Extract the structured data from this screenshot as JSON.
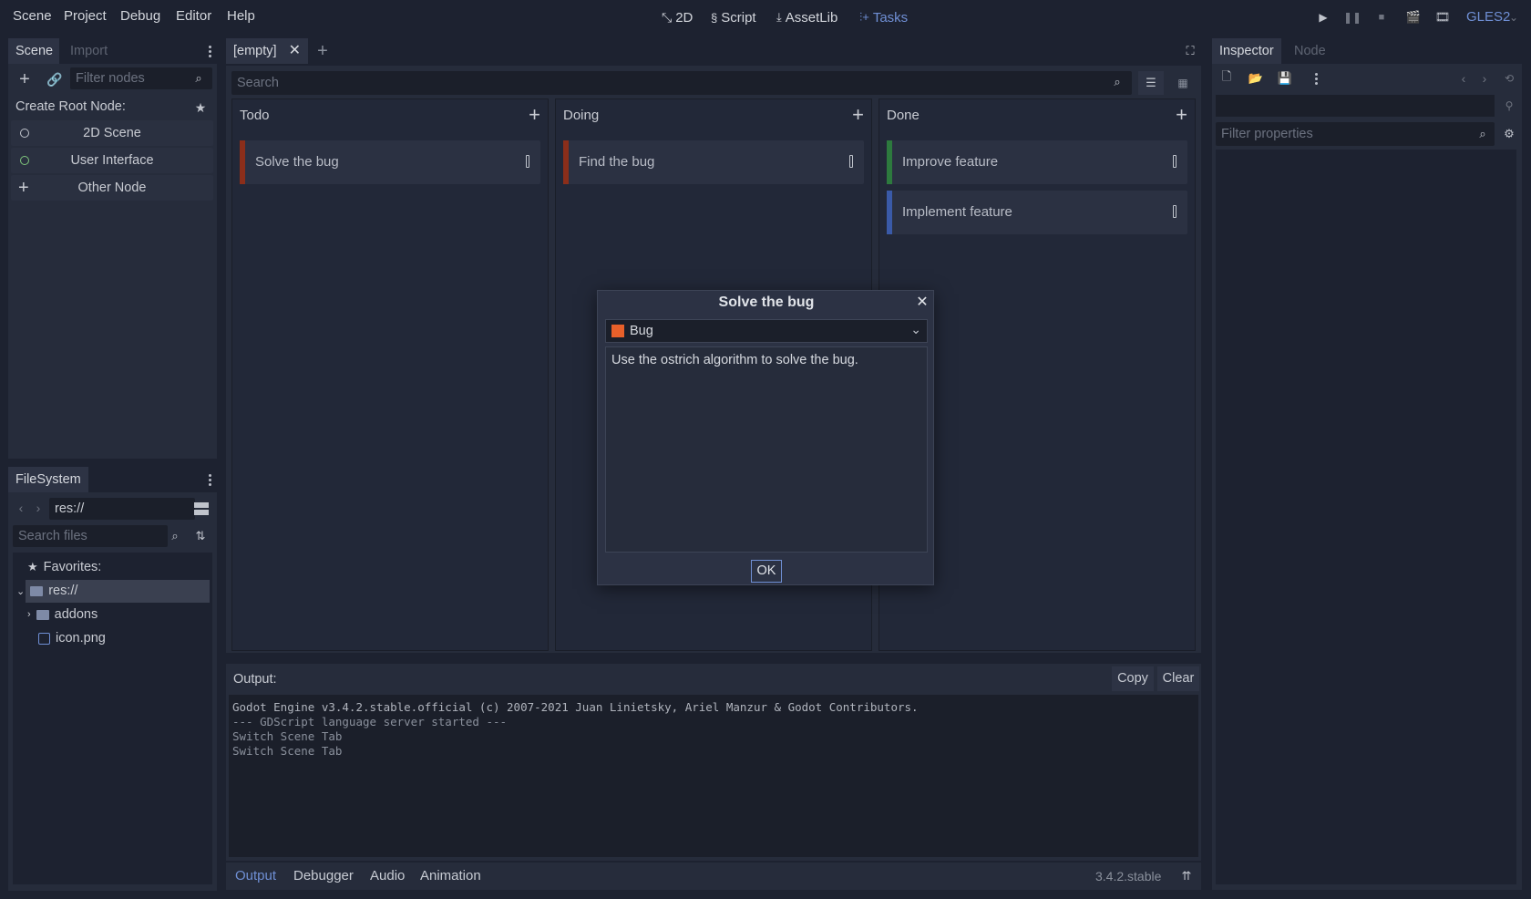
{
  "menu": [
    "Scene",
    "Project",
    "Debug",
    "Editor",
    "Help"
  ],
  "workspaces": [
    {
      "label": "2D",
      "icon": "2d-icon"
    },
    {
      "label": "Script",
      "icon": "script-icon"
    },
    {
      "label": "AssetLib",
      "icon": "assetlib-icon"
    },
    {
      "label": "Tasks",
      "icon": "tasks-icon",
      "active": true
    }
  ],
  "renderer": "GLES2",
  "scene_dock": {
    "tabs": [
      "Scene",
      "Import"
    ],
    "filter_placeholder": "Filter nodes",
    "create_root_label": "Create Root Node:",
    "root_options": [
      "2D Scene",
      "User Interface",
      "Other Node"
    ]
  },
  "filesystem_dock": {
    "title": "FileSystem",
    "path": "res://",
    "search_placeholder": "Search files",
    "favorites_label": "Favorites:",
    "tree": {
      "root": "res://",
      "children": [
        "addons",
        "icon.png"
      ]
    }
  },
  "editor_tabs": {
    "active": "[empty]"
  },
  "board": {
    "search_placeholder": "Search",
    "columns": [
      {
        "title": "Todo",
        "cards": [
          {
            "title": "Solve the bug",
            "color": "#8b2e1a"
          }
        ]
      },
      {
        "title": "Doing",
        "cards": [
          {
            "title": "Find the bug",
            "color": "#8b2e1a"
          }
        ]
      },
      {
        "title": "Done",
        "cards": [
          {
            "title": "Improve feature",
            "color": "#2d7a3e"
          },
          {
            "title": "Implement feature",
            "color": "#3a5aa8"
          }
        ]
      }
    ]
  },
  "dialog": {
    "title": "Solve the bug",
    "category": "Bug",
    "category_color": "#e8602a",
    "description": "Use the ostrich algorithm to solve the bug.",
    "ok_label": "OK"
  },
  "output": {
    "title": "Output:",
    "copy_label": "Copy",
    "clear_label": "Clear",
    "lines": [
      "Godot Engine v3.4.2.stable.official (c) 2007-2021 Juan Linietsky, Ariel Manzur & Godot Contributors.",
      "--- GDScript language server started ---",
      "Switch Scene Tab",
      "Switch Scene Tab"
    ]
  },
  "bottom_tabs": [
    "Output",
    "Debugger",
    "Audio",
    "Animation"
  ],
  "version": "3.4.2.stable",
  "inspector": {
    "tabs": [
      "Inspector",
      "Node"
    ],
    "filter_placeholder": "Filter properties"
  }
}
